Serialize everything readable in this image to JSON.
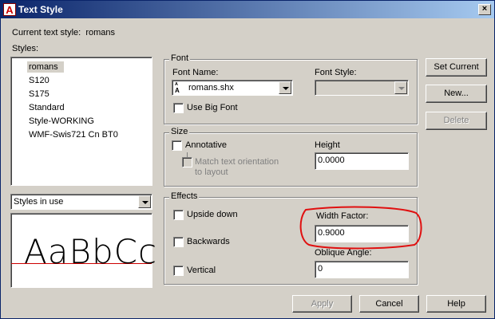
{
  "window": {
    "title": "Text Style",
    "icon_letter": "A",
    "close_glyph": "×"
  },
  "current_style": {
    "label": "Current text style:",
    "value": "romans"
  },
  "styles": {
    "label": "Styles:",
    "items": [
      "romans",
      "S120",
      "S175",
      "Standard",
      "Style-WORKING",
      "WMF-Swis721 Cn BT0"
    ],
    "selected": "romans",
    "filter": "Styles in use"
  },
  "preview": {
    "text": "AaBbCc"
  },
  "font": {
    "group_label": "Font",
    "name_label": "Font Name:",
    "name_value": "romans.shx",
    "style_label": "Font Style:",
    "style_value": "",
    "bigfont_label": "Use Big Font"
  },
  "size": {
    "group_label": "Size",
    "annotative_label": "Annotative",
    "match_label_line1": "Match text orientation",
    "match_label_line2": "to layout",
    "height_label": "Height",
    "height_value": "0.0000"
  },
  "effects": {
    "group_label": "Effects",
    "upside_down_label": "Upside down",
    "backwards_label": "Backwards",
    "vertical_label": "Vertical",
    "width_label": "Width Factor:",
    "width_value": "0.9000",
    "oblique_label": "Oblique Angle:",
    "oblique_value": "0"
  },
  "buttons": {
    "set_current": "Set Current",
    "new": "New...",
    "delete": "Delete",
    "apply": "Apply",
    "cancel": "Cancel",
    "help": "Help"
  },
  "colors": {
    "annotation": "#e01010",
    "title_start": "#0a246a",
    "title_end": "#a6caf0",
    "face": "#d4d0c8"
  }
}
